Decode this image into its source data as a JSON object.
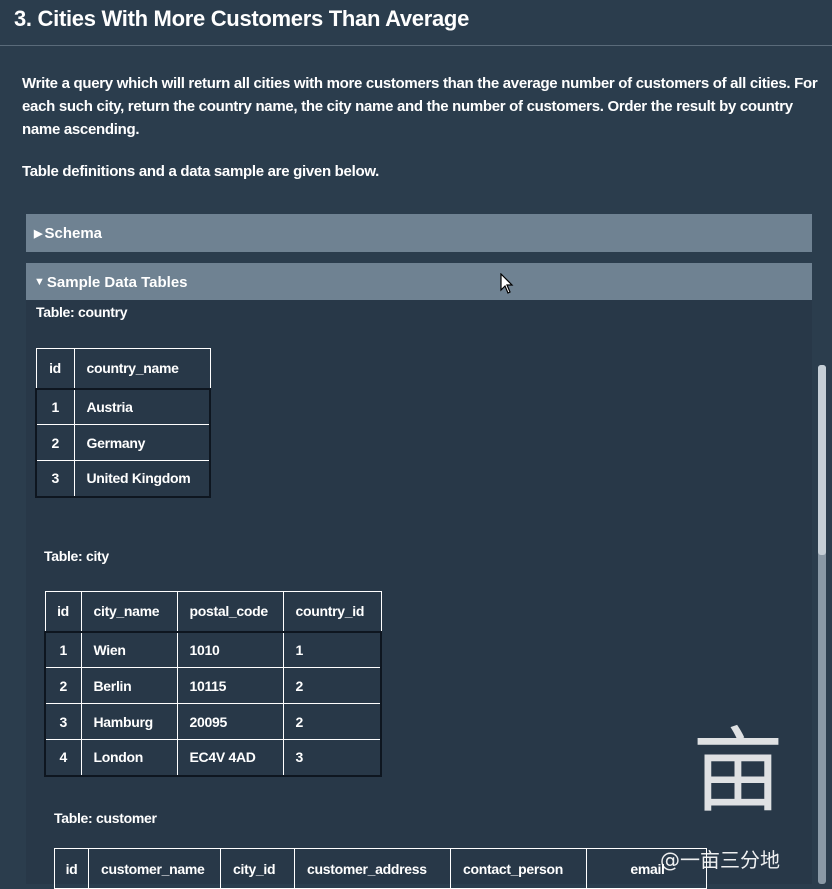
{
  "page": {
    "title": "3. Cities With More Customers Than Average",
    "description": "Write a query which will return all cities with more customers than the average number of customers of all cities. For each such city, return the country name, the city name and the number of customers. Order the result by country name ascending.",
    "note": "Table definitions and a data sample are given below."
  },
  "panels": {
    "schema": {
      "arrow": "▶",
      "label": "Schema"
    },
    "sample": {
      "arrow": "▼",
      "label": "Sample Data Tables"
    }
  },
  "tables": {
    "country": {
      "label": "Table: country",
      "columns": [
        "id",
        "country_name"
      ],
      "rows": [
        [
          "1",
          "Austria"
        ],
        [
          "2",
          "Germany"
        ],
        [
          "3",
          "United Kingdom"
        ]
      ]
    },
    "city": {
      "label": "Table: city",
      "columns": [
        "id",
        "city_name",
        "postal_code",
        "country_id"
      ],
      "rows": [
        [
          "1",
          "Wien",
          "1010",
          "1"
        ],
        [
          "2",
          "Berlin",
          "10115",
          "2"
        ],
        [
          "3",
          "Hamburg",
          "20095",
          "2"
        ],
        [
          "4",
          "London",
          "EC4V 4AD",
          "3"
        ]
      ]
    },
    "customer": {
      "label": "Table: customer",
      "columns": [
        "id",
        "customer_name",
        "city_id",
        "customer_address",
        "contact_person",
        "email"
      ]
    }
  },
  "watermark": {
    "mark": "亩",
    "text": "@一亩三分地"
  },
  "colors": {
    "background": "#2b3d4d",
    "panel": "#6f8292",
    "text": "#ffffff"
  },
  "icons": {
    "cursor": "mouse-pointer-icon"
  }
}
